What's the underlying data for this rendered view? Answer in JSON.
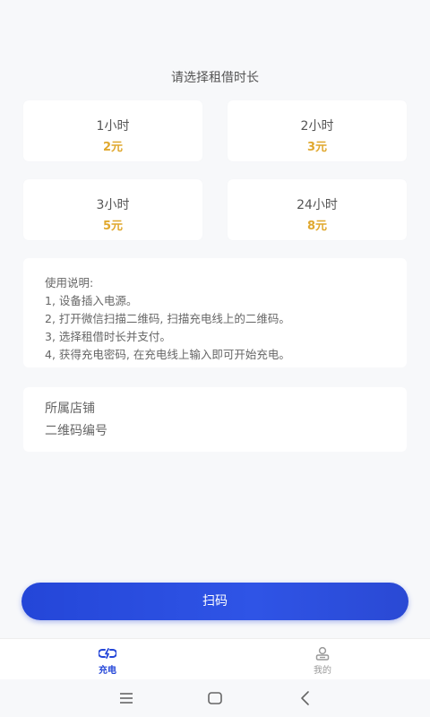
{
  "header": {
    "title": "请选择租借时长"
  },
  "rental_options": [
    {
      "duration": "1小时",
      "price": "2元"
    },
    {
      "duration": "2小时",
      "price": "3元"
    },
    {
      "duration": "3小时",
      "price": "5元"
    },
    {
      "duration": "24小时",
      "price": "8元"
    }
  ],
  "instructions": {
    "heading": "使用说明:",
    "steps": [
      "1, 设备插入电源。",
      "2, 打开微信扫描二维码, 扫描充电线上的二维码。",
      "3, 选择租借时长并支付。",
      "4, 获得充电密码, 在充电线上输入即可开始充电。"
    ]
  },
  "shop": {
    "store_label": "所属店铺",
    "qr_code_label": "二维码编号"
  },
  "scan_button": {
    "label": "扫码"
  },
  "tab_bar": {
    "tabs": [
      {
        "label": "充电",
        "icon": "charging-icon",
        "active": true
      },
      {
        "label": "我的",
        "icon": "profile-icon",
        "active": false
      }
    ]
  },
  "system_nav": {
    "buttons": [
      "menu-icon",
      "home-icon",
      "back-icon"
    ]
  },
  "colors": {
    "accent": "#2446d8",
    "price": "#e0a82e",
    "background": "#f7f8fa"
  }
}
